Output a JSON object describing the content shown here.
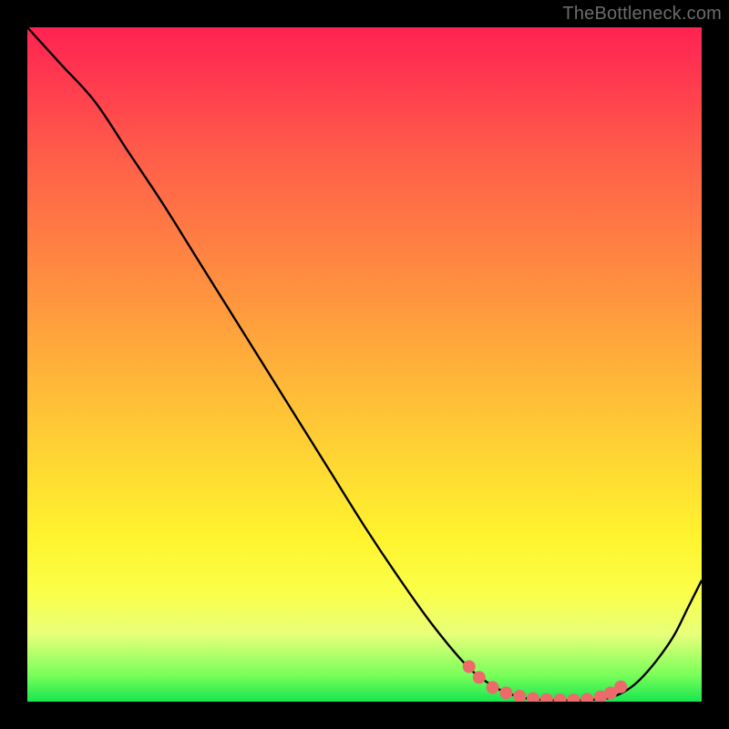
{
  "watermark": "TheBottleneck.com",
  "chart_data": {
    "type": "line",
    "title": "",
    "xlabel": "",
    "ylabel": "",
    "xlim": [
      0,
      100
    ],
    "ylim": [
      0,
      100
    ],
    "series": [
      {
        "name": "curve",
        "x": [
          0,
          5,
          10,
          15,
          20,
          25,
          30,
          35,
          40,
          45,
          50,
          55,
          60,
          65,
          68,
          70,
          72,
          74,
          76,
          78,
          80,
          82,
          84,
          86,
          88,
          90,
          92,
          94,
          96,
          98,
          100
        ],
        "y": [
          100,
          94.5,
          89,
          81.5,
          74,
          66,
          58,
          50,
          42,
          34,
          26,
          18.5,
          11.5,
          5.5,
          3,
          1.8,
          1,
          0.5,
          0.3,
          0.2,
          0.2,
          0.2,
          0.3,
          0.5,
          1.2,
          2.5,
          4.5,
          7,
          10,
          14,
          18
        ]
      }
    ],
    "highlight_dots": {
      "name": "bottom-dots",
      "x": [
        65.5,
        67,
        69,
        71,
        73,
        75,
        77,
        79,
        81,
        83,
        85,
        86.5,
        88
      ],
      "y": [
        5.2,
        3.6,
        2.1,
        1.3,
        0.8,
        0.45,
        0.3,
        0.25,
        0.25,
        0.35,
        0.7,
        1.3,
        2.2
      ]
    },
    "background_gradient": {
      "top": "#ff2352",
      "mid": "#ffdb32",
      "bottom": "#17e64f"
    }
  }
}
